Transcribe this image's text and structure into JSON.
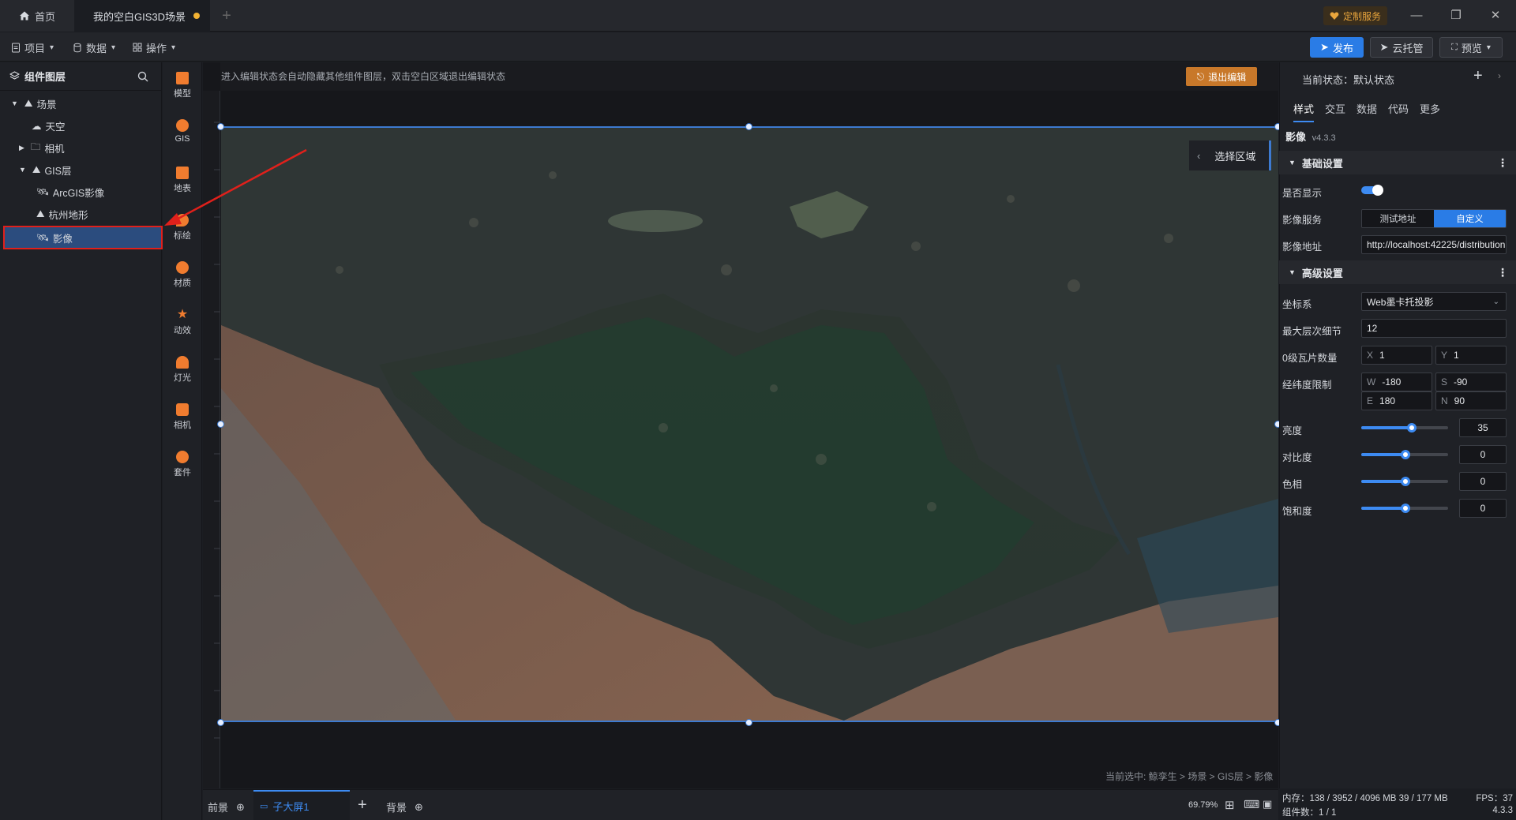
{
  "titlebar": {
    "home_tab": "首页",
    "scene_tab": "我的空白GIS3D场景",
    "custom_service": "定制服务"
  },
  "menubar": {
    "project": "项目",
    "data": "数据",
    "operate": "操作",
    "publish": "发布",
    "cloud_host": "云托管",
    "preview": "预览"
  },
  "layers": {
    "title": "组件图层",
    "items": [
      {
        "label": "场景"
      },
      {
        "label": "天空"
      },
      {
        "label": "相机"
      },
      {
        "label": "GIS层"
      },
      {
        "label": "ArcGIS影像"
      },
      {
        "label": "杭州地形"
      },
      {
        "label": "影像"
      }
    ]
  },
  "toolbar": {
    "items": [
      "模型",
      "GIS",
      "地表",
      "标绘",
      "材质",
      "动效",
      "灯光",
      "相机",
      "套件"
    ]
  },
  "canvas": {
    "hint": "进入编辑状态会自动隐藏其他组件图层，双击空白区域退出编辑状态",
    "exit_edit": "退出编辑",
    "select_area": "选择区域",
    "breadcrumb": "当前选中: 鲸孪生 > 场景 > GIS层 > 影像"
  },
  "bottom": {
    "foreground": "前景",
    "sub_screen": "子大屏1",
    "background": "背景",
    "zoom": "69.79%"
  },
  "panel": {
    "state_label": "当前状态：",
    "state_value": "默认状态",
    "tabs": [
      "样式",
      "交互",
      "数据",
      "代码",
      "更多"
    ],
    "component_name": "影像",
    "component_version": "v4.3.3",
    "basic_section": "基础设置",
    "show_label": "是否显示",
    "service_label": "影像服务",
    "service_options": [
      "测试地址",
      "自定义"
    ],
    "url_label": "影像地址",
    "url_value": "http://localhost:42225/distribution",
    "advanced_section": "高级设置",
    "crs_label": "坐标系",
    "crs_value": "Web墨卡托投影",
    "max_level_label": "最大层次细节",
    "max_level_value": "12",
    "tiles_label": "0级瓦片数量",
    "tiles_x": "1",
    "tiles_y": "1",
    "bounds_label": "经纬度限制",
    "bounds_w": "-180",
    "bounds_s": "-90",
    "bounds_e": "180",
    "bounds_n": "90",
    "brightness_label": "亮度",
    "brightness_value": "35",
    "contrast_label": "对比度",
    "contrast_value": "0",
    "hue_label": "色相",
    "hue_value": "0",
    "saturation_label": "饱和度",
    "saturation_value": "0"
  },
  "status": {
    "memory": "内存：138 / 3952 / 4096 MB  39 / 177 MB",
    "fps": "FPS：37",
    "components": "组件数：1 / 1",
    "version": "4.3.3"
  }
}
